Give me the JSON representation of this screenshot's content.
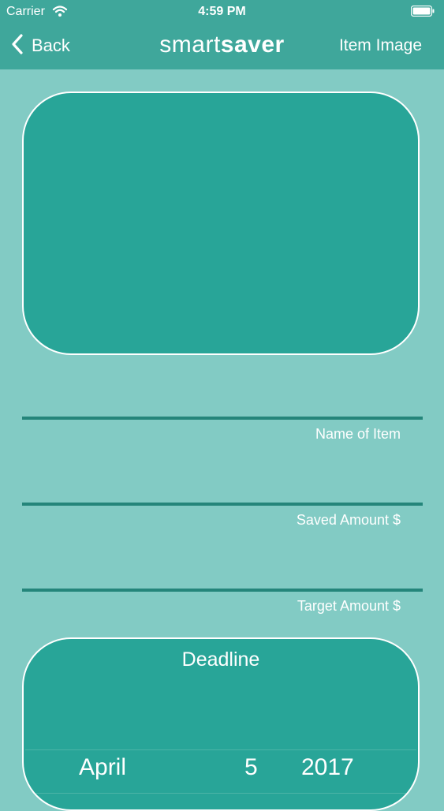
{
  "status_bar": {
    "carrier": "Carrier",
    "time": "4:59 PM"
  },
  "nav": {
    "back_label": "Back",
    "title_light": "smart",
    "title_bold": "saver",
    "right_button": "Item Image"
  },
  "fields": [
    {
      "label": "Name of Item",
      "value": ""
    },
    {
      "label": "Saved Amount $",
      "value": ""
    },
    {
      "label": "Target Amount $",
      "value": ""
    }
  ],
  "deadline": {
    "title": "Deadline",
    "selected": {
      "month": "April",
      "day": "5",
      "year": "2017"
    }
  },
  "colors": {
    "background": "#82cbc4",
    "bar": "#3fa79b",
    "card": "#28a598",
    "line": "#24857a"
  },
  "icons": [
    "wifi-icon",
    "battery-icon",
    "chevron-left-icon"
  ]
}
